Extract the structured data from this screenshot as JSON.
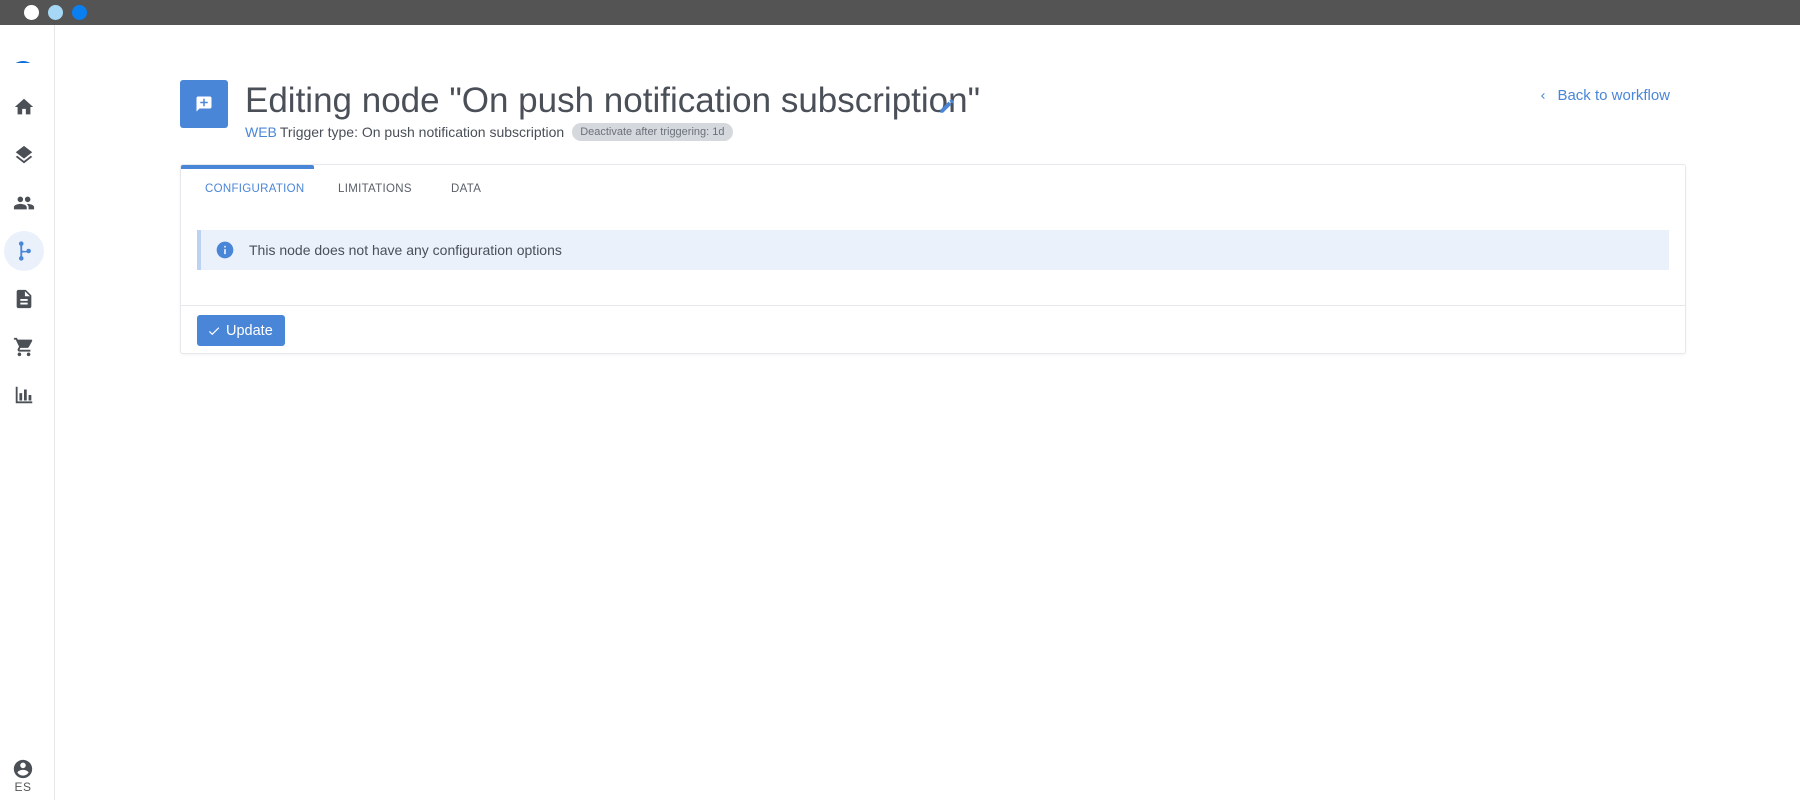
{
  "window": {
    "controls": [
      "close",
      "minimize",
      "maximize"
    ]
  },
  "sidebar": {
    "logo_icon": "brand-arc-logo",
    "items": [
      {
        "icon": "home-icon",
        "active": false
      },
      {
        "icon": "layers-icon",
        "active": false
      },
      {
        "icon": "people-icon",
        "active": false
      },
      {
        "icon": "workflow-branch-icon",
        "active": true
      },
      {
        "icon": "document-icon",
        "active": false
      },
      {
        "icon": "cart-icon",
        "active": false
      },
      {
        "icon": "bar-chart-icon",
        "active": false
      }
    ],
    "profile_icon": "account-circle-icon",
    "language": "ES"
  },
  "header": {
    "node_icon": "message-plus-icon",
    "title": "Editing node \"On push notification subscription\"",
    "edit_icon": "pencil-icon",
    "platform": "WEB",
    "trigger_type": "Trigger type: On push notification subscription",
    "badge": "Deactivate after triggering: 1d",
    "back_link": "Back to workflow"
  },
  "tabs": [
    {
      "label": "CONFIGURATION",
      "active": true
    },
    {
      "label": "LIMITATIONS",
      "active": false
    },
    {
      "label": "DATA",
      "active": false
    }
  ],
  "info": {
    "icon": "info-icon",
    "text": "This node does not have any configuration options"
  },
  "actions": {
    "update_label": "Update",
    "update_icon": "check-icon"
  },
  "colors": {
    "accent": "#4a86d8",
    "titlebar": "#545454",
    "info_bg": "#eaf1fb",
    "badge_bg": "#d5d8dd"
  }
}
